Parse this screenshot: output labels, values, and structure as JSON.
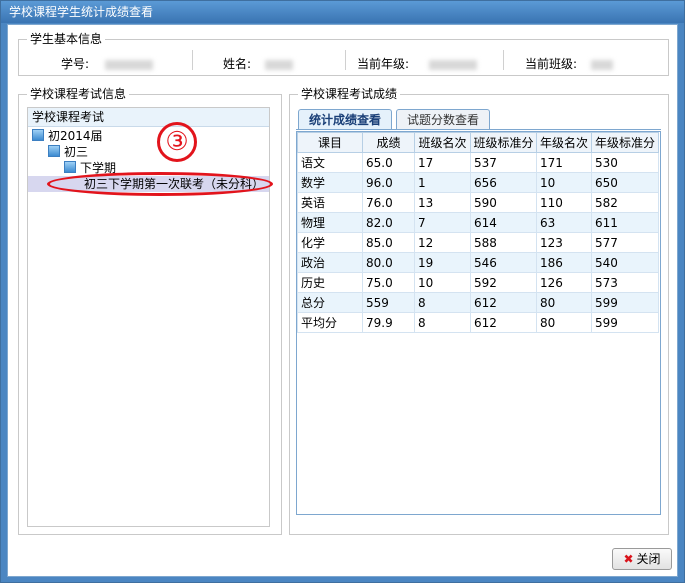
{
  "window": {
    "title": "学校课程学生统计成绩查看"
  },
  "basic_info": {
    "legend": "学生基本信息",
    "student_no_label": "学号:",
    "name_label": "姓名:",
    "grade_label": "当前年级:",
    "class_label": "当前班级:"
  },
  "exam_info": {
    "legend": "学校课程考试信息",
    "tree_header": "学校课程考试",
    "nodes": [
      "初2014届",
      "初三",
      "下学期",
      "初三下学期第一次联考（未分科）"
    ]
  },
  "annotation": {
    "number": "③"
  },
  "scores": {
    "legend": "学校课程考试成绩",
    "tabs": [
      "统计成绩查看",
      "试题分数查看"
    ],
    "columns": [
      "课目",
      "成绩",
      "班级名次",
      "班级标准分",
      "年级名次",
      "年级标准分"
    ],
    "rows": [
      [
        "语文",
        "65.0",
        "17",
        "537",
        "171",
        "530"
      ],
      [
        "数学",
        "96.0",
        "1",
        "656",
        "10",
        "650"
      ],
      [
        "英语",
        "76.0",
        "13",
        "590",
        "110",
        "582"
      ],
      [
        "物理",
        "82.0",
        "7",
        "614",
        "63",
        "611"
      ],
      [
        "化学",
        "85.0",
        "12",
        "588",
        "123",
        "577"
      ],
      [
        "政治",
        "80.0",
        "19",
        "546",
        "186",
        "540"
      ],
      [
        "历史",
        "75.0",
        "10",
        "592",
        "126",
        "573"
      ],
      [
        "总分",
        "559",
        "8",
        "612",
        "80",
        "599"
      ],
      [
        "平均分",
        "79.9",
        "8",
        "612",
        "80",
        "599"
      ]
    ]
  },
  "footer": {
    "close_label": "关闭"
  }
}
